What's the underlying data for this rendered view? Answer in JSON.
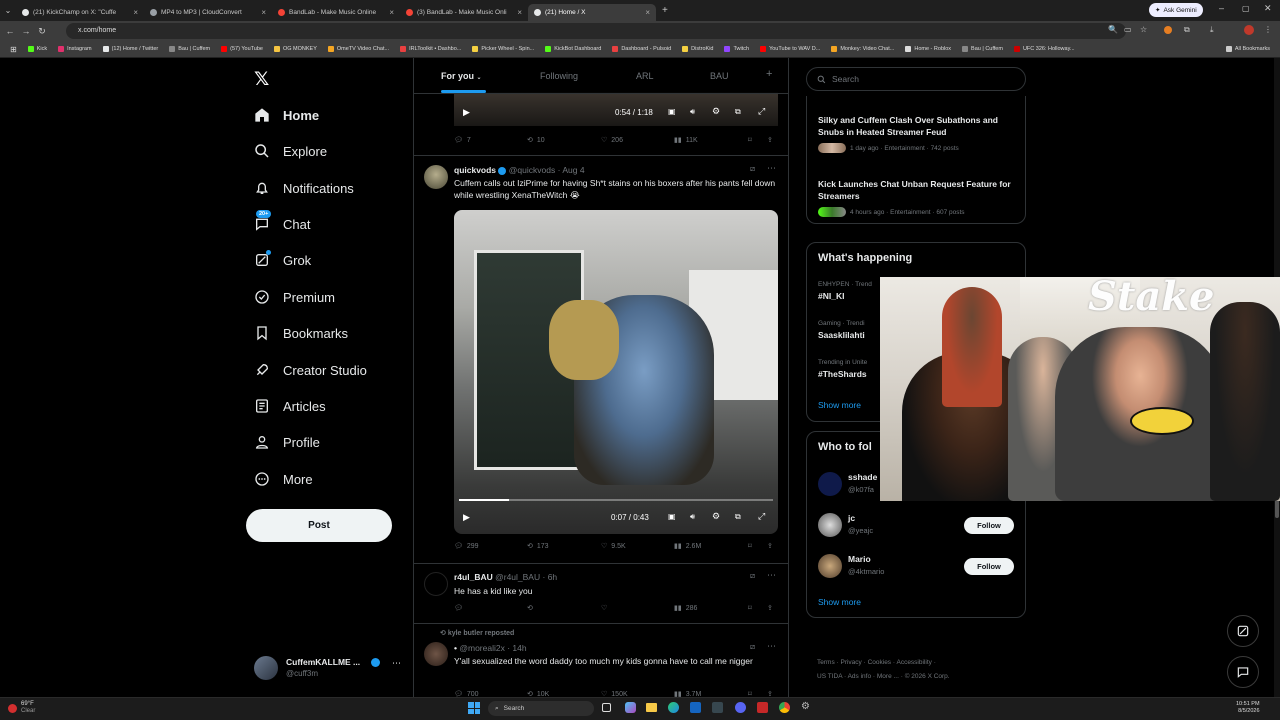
{
  "browser": {
    "tabs": [
      {
        "title": "(21) KickChamp on X: \"Cuffe",
        "color": "#e7e9ea"
      },
      {
        "title": "MP4 to MP3 | CloudConvert",
        "color": "#9aa0a6"
      },
      {
        "title": "BandLab - Make Music Online",
        "color": "#f44336"
      },
      {
        "title": "(3) BandLab - Make Music Onli",
        "color": "#f44336"
      },
      {
        "title": "(21) Home / X",
        "color": "#e7e9ea"
      }
    ],
    "url": "x.com/home",
    "ask_gemini": "Ask Gemini",
    "bookmarks": [
      {
        "label": "Kick",
        "color": "#53fc18"
      },
      {
        "label": "Instagram",
        "color": "#e1306c"
      },
      {
        "label": "(12) Home / Twitter",
        "color": "#e7e9ea"
      },
      {
        "label": "Bau | Cuffem",
        "color": "#888"
      },
      {
        "label": "(57) YouTube",
        "color": "#ff0000"
      },
      {
        "label": "OG MONKEY",
        "color": "#f5c542"
      },
      {
        "label": "OmeTV Video Chat...",
        "color": "#f5a623"
      },
      {
        "label": "IRLToolkit • Dashbo...",
        "color": "#e94040"
      },
      {
        "label": "Picker Wheel - Spin...",
        "color": "#f5d142"
      },
      {
        "label": "KickBot Dashboard",
        "color": "#53fc18"
      },
      {
        "label": "Dashboard - Pulsoid",
        "color": "#e94040"
      },
      {
        "label": "DistroKid",
        "color": "#f5d142"
      },
      {
        "label": "Twitch",
        "color": "#9146ff"
      },
      {
        "label": "YouTube to WAV D...",
        "color": "#ff0000"
      },
      {
        "label": "Monkey: Video Chat...",
        "color": "#f5a623"
      },
      {
        "label": "Home - Roblox",
        "color": "#ddd"
      },
      {
        "label": "Bau | Cuffem",
        "color": "#888"
      },
      {
        "label": "UFC 326: Holloway...",
        "color": "#c00"
      }
    ],
    "all_bookmarks": "All Bookmarks"
  },
  "nav": {
    "items": [
      "Home",
      "Explore",
      "Notifications",
      "Chat",
      "Grok",
      "Premium",
      "Bookmarks",
      "Creator Studio",
      "Articles",
      "Profile",
      "More"
    ],
    "chat_badge": "20+",
    "post_label": "Post",
    "account_name": "CuffemKALLME ...",
    "account_handle": "@cuff3m"
  },
  "feed": {
    "tabs": [
      "For you",
      "Following",
      "ARL",
      "BAU"
    ],
    "top_video": {
      "time": "0:54 / 1:18"
    },
    "top_actions": {
      "replies": "7",
      "reposts": "10",
      "likes": "206",
      "views": "11K"
    },
    "tweet1": {
      "name": "quickvods",
      "handle": "@quickvods",
      "date": "· Aug 4",
      "text": "Cuffem calls out IziPrime for having Sh*t stains on his boxers after his pants fell down while wrestling XenaTheWitch 😭",
      "video_time": "0:07 / 0:43",
      "progress": 0.16,
      "replies": "299",
      "reposts": "173",
      "likes": "9.5K",
      "views": "2.6M"
    },
    "tweet2": {
      "name": "r4ul_BAU",
      "handle": "@r4ul_BAU",
      "date": "· 6h",
      "text": "He has a kid like you",
      "views": "286"
    },
    "tweet3": {
      "reposted_by": "kyle butler reposted",
      "name": "•",
      "handle": "@moreali2x",
      "date": "· 14h",
      "text": "Y'all sexualized the word daddy too much my kids gonna have to call me nigger",
      "replies": "700",
      "reposts": "10K",
      "likes": "150K",
      "views": "3.7M"
    }
  },
  "right": {
    "search_placeholder": "Search",
    "news": [
      {
        "title": "Silky and Cuffem Clash Over Subathons and Snubs in Heated Streamer Feud",
        "meta": "1 day ago · Entertainment · 742 posts"
      },
      {
        "title": "Kick Launches Chat Unban Request Feature for Streamers",
        "meta": "4 hours ago · Entertainment · 607 posts"
      }
    ],
    "happening_title": "What's happening",
    "trends": [
      {
        "context": "ENHYPEN · Trend",
        "name": "#NI_KI"
      },
      {
        "context": "Gaming · Trendi",
        "name": "Saasklilahti"
      },
      {
        "context": "Trending in Unite",
        "name": "#TheShards"
      }
    ],
    "show_more": "Show more",
    "who_title": "Who to fol",
    "who": [
      {
        "name": "sshade",
        "handle": "@k07fa"
      },
      {
        "name": "jc",
        "handle": "@yeajc",
        "button": "Follow"
      },
      {
        "name": "Mario",
        "handle": "@4ktmario",
        "button": "Follow"
      }
    ],
    "show_more2": "Show more",
    "footer": [
      "Terms",
      "Privacy",
      "Cookies",
      "Accessibility",
      "US TIDA",
      "Ads info",
      "More ...",
      "© 2026 X Corp."
    ]
  },
  "overlay": {
    "brand": "Stake"
  },
  "taskbar": {
    "weather_temp": "69°F",
    "weather_desc": "Clear",
    "search": "Search",
    "time": "10:51 PM",
    "date": "8/5/2026"
  }
}
